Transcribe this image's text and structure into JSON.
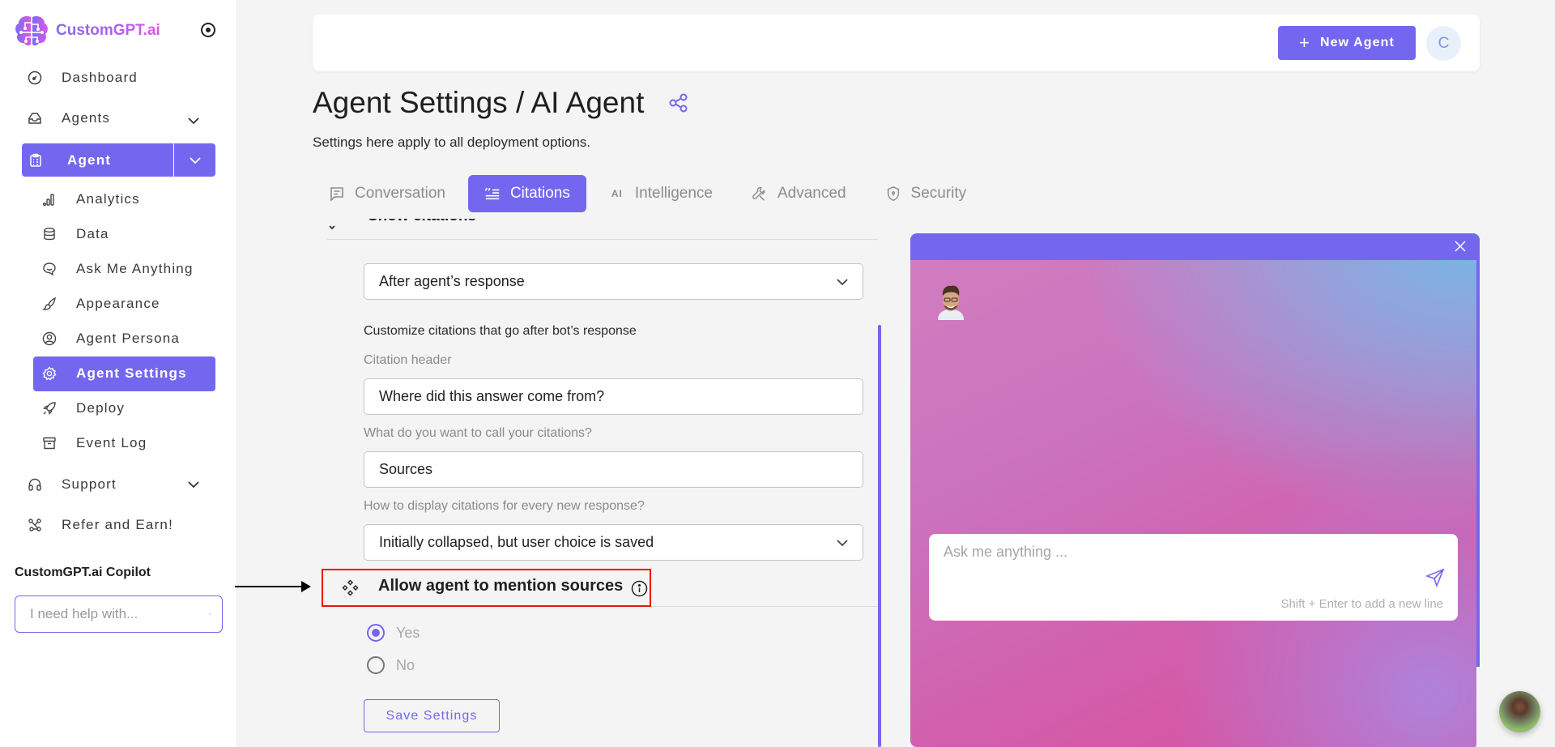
{
  "app": {
    "brand": "CustomGPT.ai"
  },
  "sidebar": {
    "items": [
      {
        "label": "Dashboard",
        "icon": "dashboard-gauge-icon"
      },
      {
        "label": "Agents",
        "icon": "agents-inbox-icon",
        "expandable": true
      },
      {
        "label": "Agent",
        "icon": "clipboard-icon",
        "active": true,
        "expandable": true
      }
    ],
    "sub_items": [
      {
        "label": "Analytics",
        "icon": "bar-chart-icon"
      },
      {
        "label": "Data",
        "icon": "database-icon"
      },
      {
        "label": "Ask Me Anything",
        "icon": "chat-bubble-icon"
      },
      {
        "label": "Appearance",
        "icon": "brush-icon"
      },
      {
        "label": "Agent Persona",
        "icon": "user-circle-icon"
      },
      {
        "label": "Agent Settings",
        "icon": "gear-icon",
        "active": true
      },
      {
        "label": "Deploy",
        "icon": "rocket-icon"
      },
      {
        "label": "Event Log",
        "icon": "archive-icon"
      }
    ],
    "bottom_items": [
      {
        "label": "Support",
        "icon": "headphones-icon",
        "expandable": true
      },
      {
        "label": "Refer and Earn!",
        "icon": "share-nodes-icon"
      }
    ],
    "copilot": {
      "title": "CustomGPT.ai Copilot",
      "placeholder": "I need help with..."
    }
  },
  "header": {
    "new_agent_label": "New Agent",
    "avatar_initial": "C"
  },
  "page": {
    "title": "Agent Settings / AI Agent",
    "subtitle": "Settings here apply to all deployment options."
  },
  "tabs": [
    {
      "label": "Conversation",
      "icon": "message-square-icon"
    },
    {
      "label": "Citations",
      "icon": "quote-list-icon",
      "active": true
    },
    {
      "label": "Intelligence",
      "icon": "ai-icon"
    },
    {
      "label": "Advanced",
      "icon": "wrench-icon"
    },
    {
      "label": "Security",
      "icon": "shield-icon"
    }
  ],
  "form": {
    "peek_section_title": "Show citations",
    "citation_position": {
      "value": "After agent’s response"
    },
    "customize_label": "Customize citations that go after bot’s response",
    "citation_header": {
      "label": "Citation header",
      "value": "Where did this answer come from?"
    },
    "citations_name": {
      "label": "What do you want to call your citations?",
      "value": "Sources"
    },
    "display_mode": {
      "label": "How to display citations for every new response?",
      "value": "Initially collapsed, but user choice is saved"
    },
    "mention_sources": {
      "title": "Allow agent to mention sources",
      "options": [
        {
          "label": "Yes",
          "checked": true
        },
        {
          "label": "No",
          "checked": false
        }
      ]
    },
    "save_label": "Save Settings"
  },
  "preview": {
    "chat_placeholder": "Ask me anything ...",
    "hint": "Shift + Enter to add a new line",
    "accent": "#7467ef"
  },
  "colors": {
    "accent": "#7467ef",
    "highlight": "#ee1111"
  }
}
